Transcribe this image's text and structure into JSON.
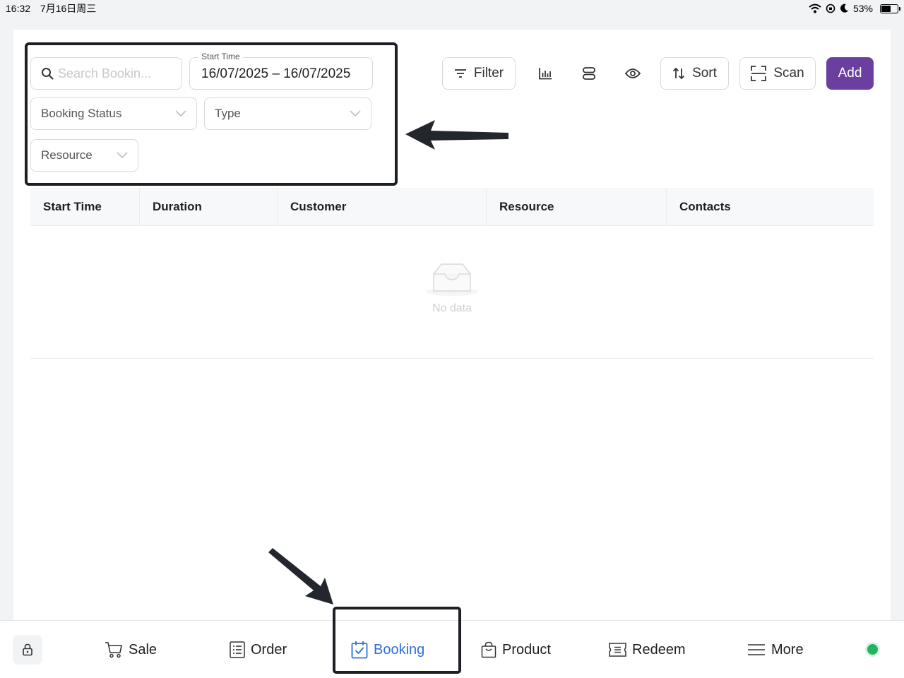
{
  "status_bar": {
    "time": "16:32",
    "date": "7月16日周三",
    "battery": "53%"
  },
  "search": {
    "placeholder": "Search Bookin..."
  },
  "date_filter": {
    "label": "Start Time",
    "value": "16/07/2025 – 16/07/2025"
  },
  "filters": {
    "booking_status": "Booking Status",
    "type": "Type",
    "resource": "Resource"
  },
  "toolbar": {
    "filter_label": "Filter",
    "sort_label": "Sort",
    "scan_label": "Scan",
    "add_label": "Add",
    "icons": [
      "bar-chart-icon",
      "layout-rows-icon",
      "eye-icon"
    ]
  },
  "table": {
    "columns": [
      "Start Time",
      "Duration",
      "Customer",
      "Resource",
      "Contacts"
    ],
    "empty_text": "No data"
  },
  "bottom_nav": {
    "items": [
      {
        "label": "Sale",
        "icon": "cart-icon"
      },
      {
        "label": "Order",
        "icon": "list-icon"
      },
      {
        "label": "Booking",
        "icon": "calendar-check-icon",
        "active": true
      },
      {
        "label": "Product",
        "icon": "bag-icon"
      },
      {
        "label": "Redeem",
        "icon": "ticket-icon"
      },
      {
        "label": "More",
        "icon": "menu-icon"
      }
    ]
  },
  "colors": {
    "accent": "#6b3fa0",
    "active_nav": "#2f6fd6",
    "online": "#22b35e"
  }
}
